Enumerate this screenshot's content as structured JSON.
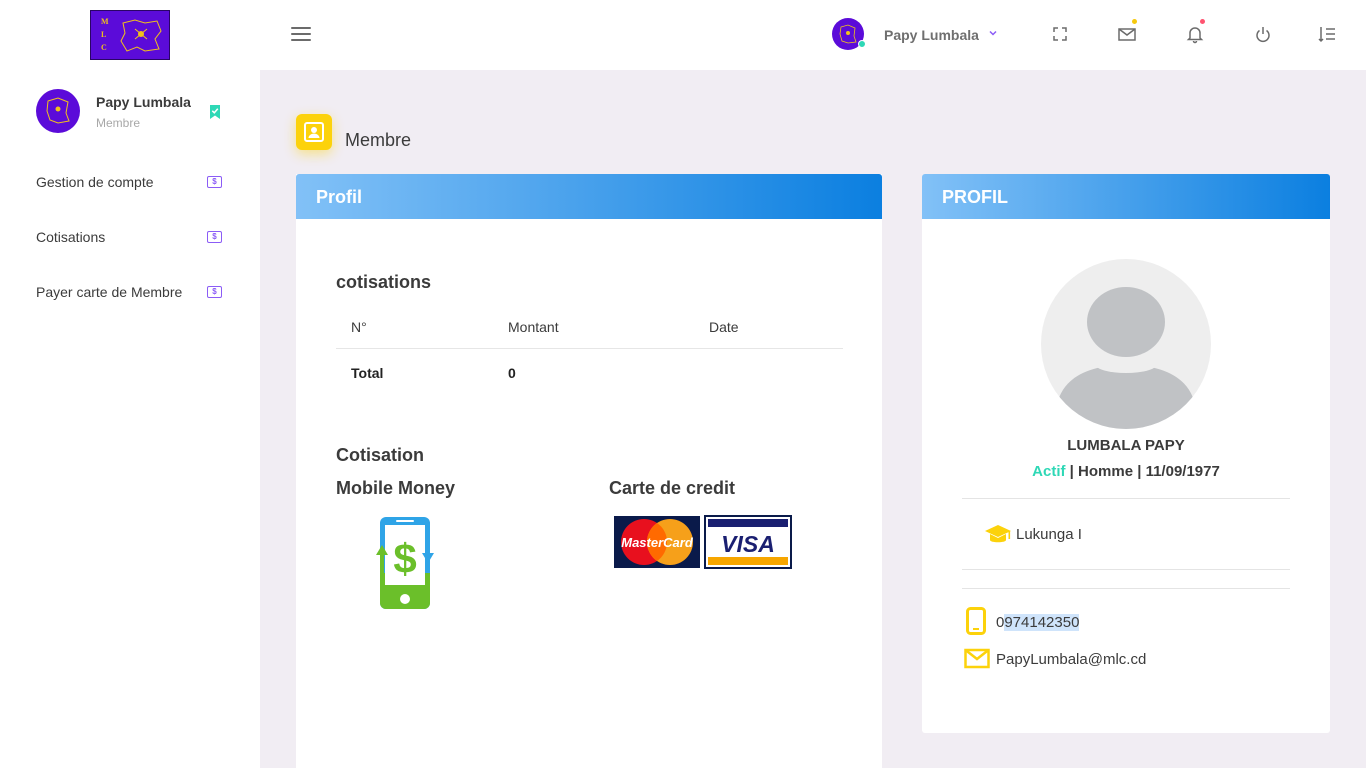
{
  "header": {
    "logo_letters": [
      "M",
      "L",
      "C"
    ],
    "user_name": "Papy Lumbala",
    "icons": [
      "menu-icon",
      "chevron-down-icon",
      "fullscreen-icon",
      "mail-icon",
      "bell-icon",
      "power-icon",
      "list-settings-icon"
    ],
    "colors": {
      "mail_badge": "#f6c90e",
      "bell_badge": "#ff5370"
    }
  },
  "sidebar": {
    "user_name": "Papy Lumbala",
    "user_role": "Membre",
    "items": [
      {
        "label": "Gestion de compte",
        "icon": "$"
      },
      {
        "label": "Cotisations",
        "icon": "$"
      },
      {
        "label": "Payer carte de Membre",
        "icon": "$"
      }
    ]
  },
  "page": {
    "title": "Membre"
  },
  "profil_card": {
    "header": "Profil",
    "cotisations_title": "cotisations",
    "table": {
      "columns": [
        "N°",
        "Montant",
        "Date"
      ],
      "total_label": "Total",
      "total_value": "0"
    },
    "cotisation_title": "Cotisation",
    "mobile_money_label": "Mobile Money",
    "credit_card_label": "Carte de credit",
    "mastercard_text": "MasterCard",
    "visa_text": "VISA"
  },
  "profile_panel": {
    "header": "PROFIL",
    "full_name": "LUMBALA PAPY",
    "status": "Actif",
    "details": " | Homme | 11/09/1977",
    "school": "Lukunga I",
    "phone_prefix": "0",
    "phone_rest": "974142350",
    "email": "PapyLumbala@mlc.cd"
  },
  "colors": {
    "accent_purple": "#5b0bd9",
    "header_gradient_start": "#82c1f7",
    "header_gradient_end": "#0b7fe0",
    "status_active": "#2ed8b6",
    "icon_yellow": "#fcd20b"
  }
}
